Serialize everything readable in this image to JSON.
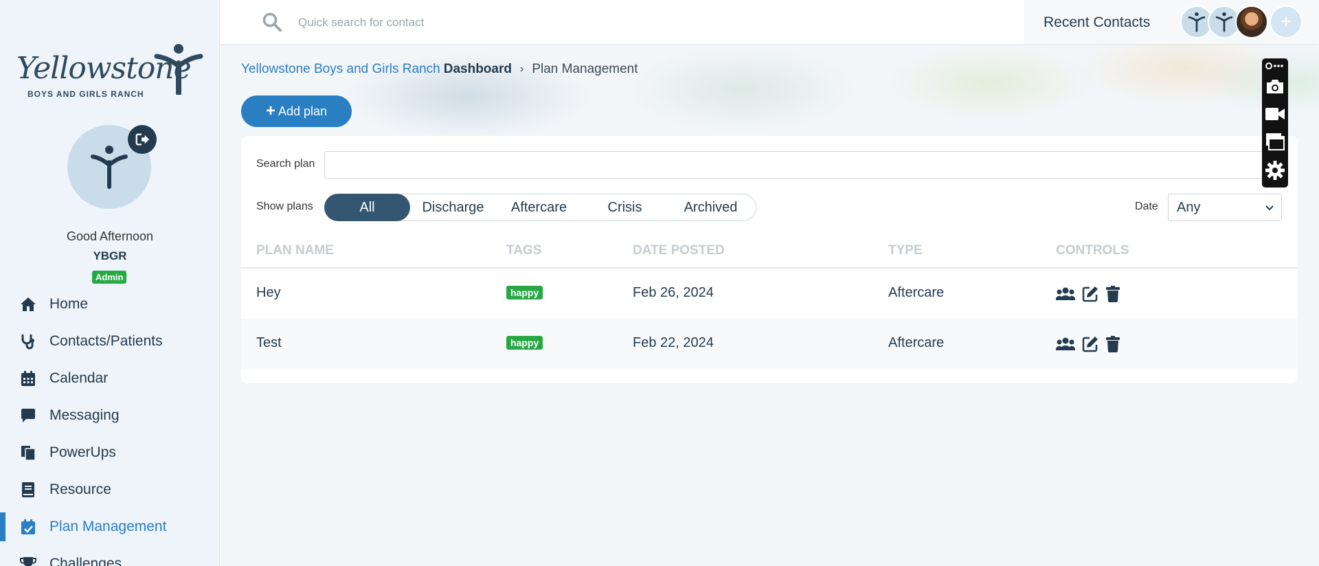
{
  "sidebar": {
    "logo": {
      "name": "Yellowstone",
      "subtitle": "BOYS AND GIRLS RANCH"
    },
    "greeting": "Good Afternoon",
    "username": "YBGR",
    "role": "Admin",
    "nav": [
      {
        "label": "Home",
        "icon": "home-icon",
        "active": false
      },
      {
        "label": "Contacts/Patients",
        "icon": "stethoscope-icon",
        "active": false
      },
      {
        "label": "Calendar",
        "icon": "calendar-icon",
        "active": false
      },
      {
        "label": "Messaging",
        "icon": "chat-icon",
        "active": false
      },
      {
        "label": "PowerUps",
        "icon": "clipboard-icon",
        "active": false
      },
      {
        "label": "Resource",
        "icon": "book-icon",
        "active": false
      },
      {
        "label": "Plan Management",
        "icon": "calendar-check-icon",
        "active": true
      },
      {
        "label": "Challenges",
        "icon": "trophy-icon",
        "active": false
      }
    ]
  },
  "topbar": {
    "search_placeholder": "Quick search for contact",
    "recent_label": "Recent Contacts"
  },
  "breadcrumb": {
    "org": "Yellowstone Boys and Girls Ranch",
    "dashboard": "Dashboard",
    "separator": "›",
    "current": "Plan Management"
  },
  "add_plan": {
    "label": "Add plan",
    "icon": "plus-icon"
  },
  "filters": {
    "search_label": "Search plan",
    "search_value": "",
    "show_label": "Show plans",
    "options": [
      "All",
      "Discharge",
      "Aftercare",
      "Crisis",
      "Archived"
    ],
    "selected": "All",
    "date_label": "Date",
    "date_value": "Any"
  },
  "table": {
    "headers": [
      "PLAN NAME",
      "TAGS",
      "DATE POSTED",
      "TYPE",
      "CONTROLS"
    ],
    "rows": [
      {
        "name": "Hey",
        "tag": "happy",
        "date": "Feb 26, 2024",
        "type": "Aftercare"
      },
      {
        "name": "Test",
        "tag": "happy",
        "date": "Feb 22, 2024",
        "type": "Aftercare"
      }
    ],
    "controls": [
      "users-icon",
      "edit-icon",
      "trash-icon"
    ]
  },
  "toolbar": {
    "buttons": [
      "link-more-icon",
      "camera-icon",
      "video-icon",
      "windows-icon",
      "gear-icon"
    ]
  },
  "colors": {
    "primary": "#2a7ec2",
    "navy": "#243b4f",
    "pill_selected": "#355670",
    "tag_green": "#27a844"
  }
}
